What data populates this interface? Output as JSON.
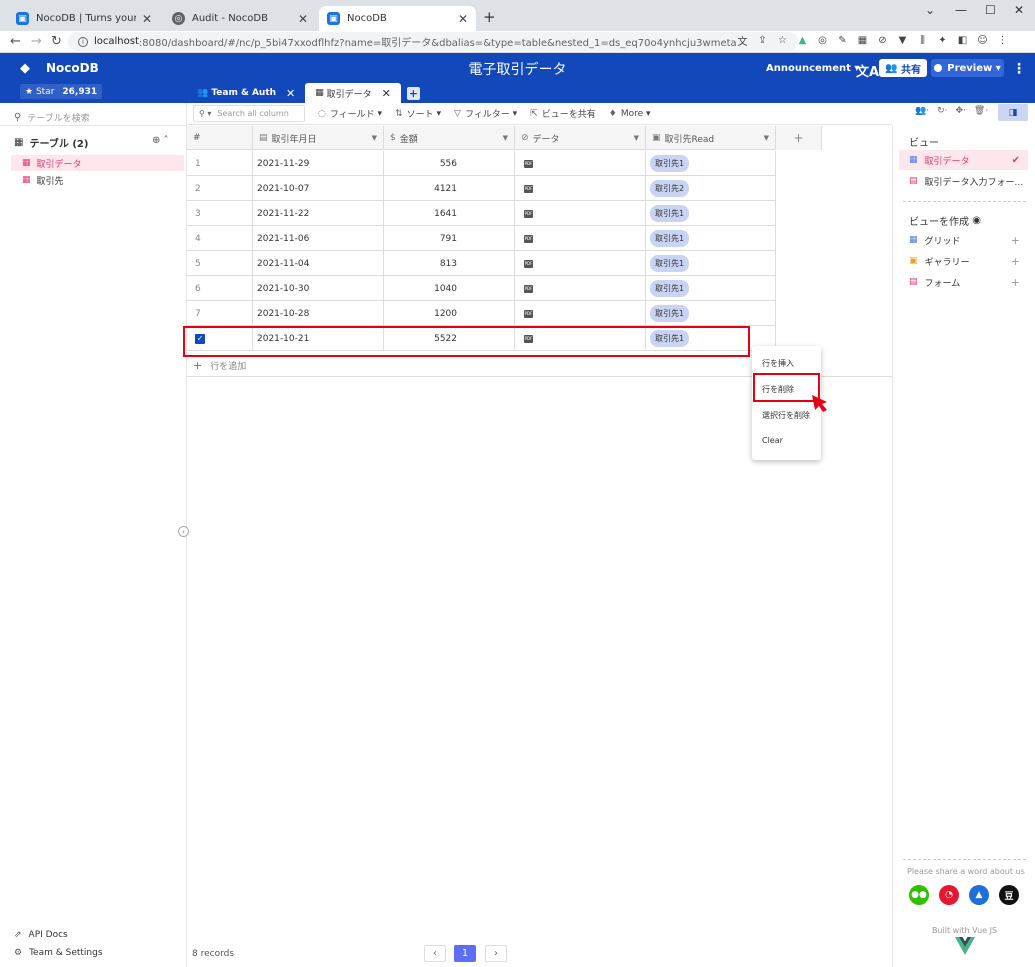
{
  "browser": {
    "tabs": [
      {
        "title": "NocoDB | Turns your SQL databa",
        "active": false
      },
      {
        "title": "Audit - NocoDB",
        "active": false
      },
      {
        "title": "NocoDB",
        "active": true
      }
    ],
    "url_host": "localhost",
    "url_path": ":8080/dashboard/#/nc/p_5bi47xxodflhfz?name=取引データ&dbalias=&type=table&nested_1=ds_eq70o4ynhcju3wmeta"
  },
  "header": {
    "logo": "NocoDB",
    "star_label": "Star",
    "star_count": "26,931",
    "title": "電子取引データ",
    "announcement": "Announcement",
    "share": "共有",
    "preview": "Preview",
    "accent": "#1348ba"
  },
  "app_tabs": [
    {
      "label": "Team & Auth",
      "active": false
    },
    {
      "label": "取引データ",
      "active": true
    }
  ],
  "sidebar": {
    "search_placeholder": "テーブルを検索",
    "tables_header": "テーブル (2)",
    "tables": [
      {
        "label": "取引データ",
        "active": true
      },
      {
        "label": "取引先",
        "active": false
      }
    ],
    "api_docs": "API Docs",
    "team_settings": "Team & Settings"
  },
  "toolbar": {
    "search_placeholder": "Search all column",
    "fields": "フィールド",
    "sort": "ソート",
    "filter": "フィルター",
    "share_view": "ビューを共有",
    "more": "More"
  },
  "grid": {
    "columns": [
      {
        "label": "#"
      },
      {
        "label": "取引年月日",
        "icon": "calendar-icon"
      },
      {
        "label": "金額",
        "icon": "currency-icon"
      },
      {
        "label": "データ",
        "icon": "attachment-icon"
      },
      {
        "label": "取引先Read",
        "icon": "link-icon"
      }
    ],
    "rows": [
      {
        "index": "1",
        "date": "2021-11-29",
        "amount": "556",
        "data": "PDF",
        "ref": "取引先1"
      },
      {
        "index": "2",
        "date": "2021-10-07",
        "amount": "4121",
        "data": "PDF",
        "ref": "取引先2"
      },
      {
        "index": "3",
        "date": "2021-11-22",
        "amount": "1641",
        "data": "PDF",
        "ref": "取引先1"
      },
      {
        "index": "4",
        "date": "2021-11-06",
        "amount": "791",
        "data": "PDF",
        "ref": "取引先1"
      },
      {
        "index": "5",
        "date": "2021-11-04",
        "amount": "813",
        "data": "PDF",
        "ref": "取引先1"
      },
      {
        "index": "6",
        "date": "2021-10-30",
        "amount": "1040",
        "data": "PDF",
        "ref": "取引先1"
      },
      {
        "index": "7",
        "date": "2021-10-28",
        "amount": "1200",
        "data": "PDF",
        "ref": "取引先1"
      },
      {
        "index": "",
        "date": "2021-10-21",
        "amount": "5522",
        "data": "PDF",
        "ref": "取引先1",
        "checked": true
      }
    ],
    "add_row": "行を追加",
    "records": "8 records",
    "page": "1"
  },
  "context_menu": {
    "items": [
      "行を挿入",
      "行を削除",
      "選択行を削除",
      "Clear"
    ],
    "highlight_color": "#e60012"
  },
  "views": {
    "header": "ビュー",
    "items": [
      {
        "label": "取引データ",
        "active": true
      },
      {
        "label": "取引データ入力フォー...",
        "active": false
      }
    ],
    "create_header": "ビューを作成",
    "create_items": [
      "グリッド",
      "ギャラリー",
      "フォーム"
    ],
    "share_prompt": "Please share a word about us",
    "built_with": "Built with Vue JS"
  }
}
